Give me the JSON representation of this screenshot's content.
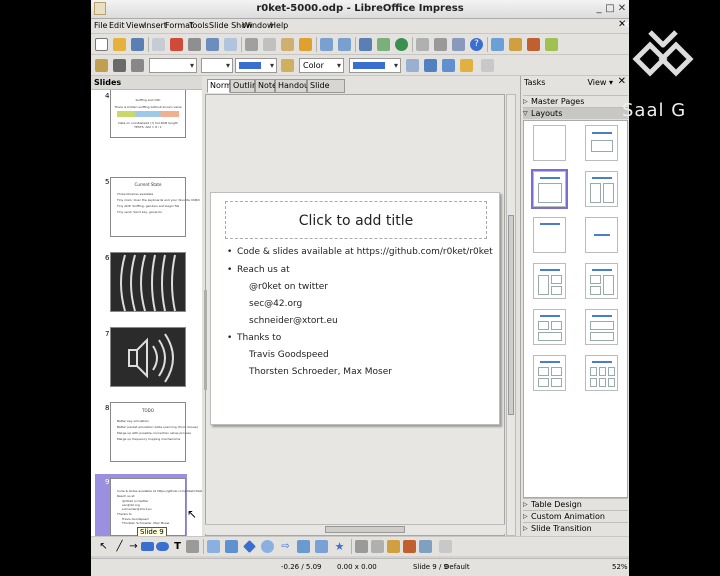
{
  "window": {
    "title": "r0ket-5000.odp - LibreOffice Impress"
  },
  "menu": [
    "File",
    "Edit",
    "View",
    "Insert",
    "Format",
    "Tools",
    "Slide Show",
    "Window",
    "Help"
  ],
  "toolbar2": {
    "color_mode": "Color"
  },
  "slides_pane": {
    "title": "Slides",
    "tooltip": "Slide 9",
    "thumbs": [
      {
        "num": "4",
        "title": "Sniffing and CRC",
        "lines": [
          "There is hidden sniffing without known value",
          "Data on uninitialized (?) full RAM length",
          "TESTS: ANI = 8 / 1"
        ]
      },
      {
        "num": "5",
        "title": "Current State",
        "lines": [
          "Three libraries available",
          "Tiny main: Over the keyboards and your favorite USB/C",
          "Tiny ADP: Sniffing, genders and begin file",
          "Tiny send: Send key, generics"
        ]
      },
      {
        "num": "6",
        "title": "",
        "lines": []
      },
      {
        "num": "7",
        "title": "",
        "lines": []
      },
      {
        "num": "8",
        "title": "TODO",
        "lines": [
          "Better key simulation",
          "Better packet emulation while scanning (from mouse)",
          "Merge up with possible connection setup process",
          "Merge up frequency hopping mechanisms"
        ]
      },
      {
        "num": "9",
        "title": "",
        "lines": [
          "Code & slides available at https://github.com/r0ket/r0ket",
          "Reach us at",
          "@r0ket on twitter",
          "sec@42.org",
          "schneider@xtort.eu",
          "Thanks to",
          "Travis Goodspeed",
          "Thorsten Schroeder, Max Moser"
        ]
      }
    ]
  },
  "view_tabs": [
    "Normal",
    "Outline",
    "Notes",
    "Handout",
    "Slide Sorter"
  ],
  "slide": {
    "title_placeholder": "Click to add title",
    "bullets": [
      {
        "level": 1,
        "text": "Code & slides available at https://github.com/r0ket/r0ket"
      },
      {
        "level": 1,
        "text": "Reach us at"
      },
      {
        "level": 2,
        "text": "@r0ket on twitter"
      },
      {
        "level": 2,
        "text": "sec@42.org"
      },
      {
        "level": 2,
        "text": "schneider@xtort.eu"
      },
      {
        "level": 1,
        "text": "Thanks to"
      },
      {
        "level": 2,
        "text": "Travis Goodspeed"
      },
      {
        "level": 2,
        "text": "Thorsten Schroeder, Max Moser"
      }
    ]
  },
  "tasks": {
    "title": "Tasks",
    "view_label": "View",
    "sections_top": [
      "Master Pages",
      "Layouts"
    ],
    "sections_bottom": [
      "Table Design",
      "Custom Animation",
      "Slide Transition"
    ]
  },
  "status": {
    "position": "-0.26 / 5.09",
    "size": "0.00 x 0.00",
    "slide": "Slide 9 / 9",
    "master": "Default",
    "zoom": "52%"
  },
  "logo": {
    "text": "Saal G"
  }
}
